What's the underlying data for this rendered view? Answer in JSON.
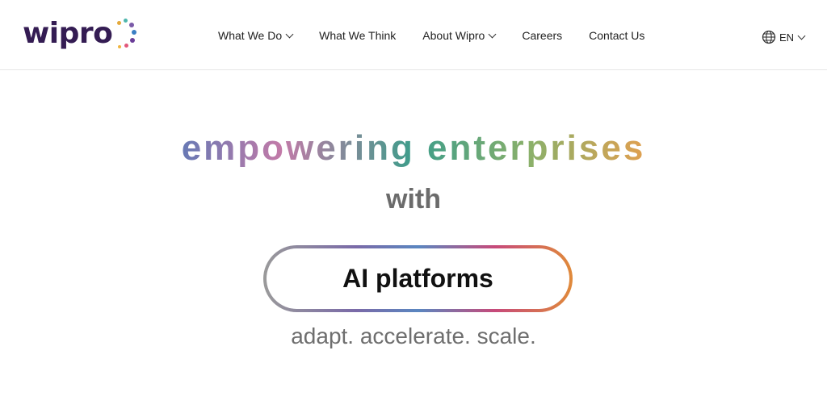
{
  "brand": {
    "name": "wipro",
    "color": "#341c53"
  },
  "nav": [
    {
      "label": "What We Do",
      "has_dropdown": true
    },
    {
      "label": "What We Think",
      "has_dropdown": false
    },
    {
      "label": "About Wipro",
      "has_dropdown": true
    },
    {
      "label": "Careers",
      "has_dropdown": false
    },
    {
      "label": "Contact Us",
      "has_dropdown": false
    }
  ],
  "language": {
    "label": "EN",
    "icon": "globe-icon"
  },
  "hero": {
    "headline": "empowering enterprises",
    "connector": "with",
    "pill_text": "AI platforms",
    "tagline": "adapt. accelerate. scale."
  }
}
